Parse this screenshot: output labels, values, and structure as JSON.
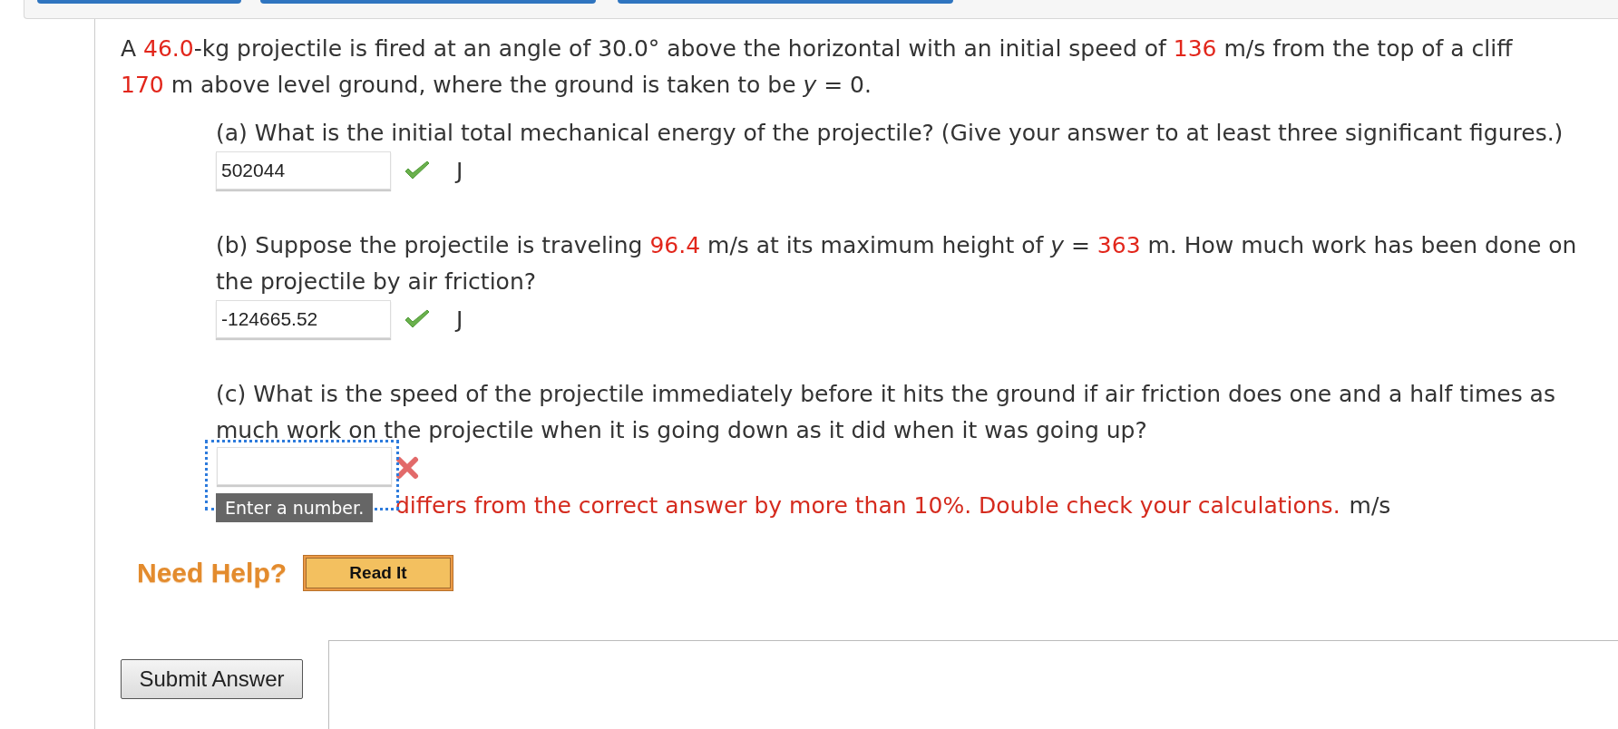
{
  "problem": {
    "segments": [
      {
        "kind": "plain",
        "text": "A "
      },
      {
        "kind": "value",
        "text": "46.0"
      },
      {
        "kind": "plain",
        "text": "-kg projectile is fired at an angle of 30.0° above the horizontal with an initial speed of "
      },
      {
        "kind": "value",
        "text": "136"
      },
      {
        "kind": "plain",
        "text": " m/s from the top of a cliff "
      },
      {
        "kind": "value",
        "text": "170"
      },
      {
        "kind": "plain",
        "text": " m above level ground, where the ground is taken to be *y* = 0."
      }
    ]
  },
  "parts": [
    {
      "segments": [
        {
          "kind": "plain",
          "text": "(a) What is the initial total mechanical energy of the projectile? (Give your answer to at least three significant figures.)"
        }
      ],
      "answer": {
        "value": "502044",
        "correct": true
      },
      "unit": "J"
    },
    {
      "segments": [
        {
          "kind": "plain",
          "text": "(b) Suppose the projectile is traveling "
        },
        {
          "kind": "value",
          "text": "96.4"
        },
        {
          "kind": "plain",
          "text": " m/s at its maximum height of *y* = "
        },
        {
          "kind": "value",
          "text": "363"
        },
        {
          "kind": "plain",
          "text": " m. How much work has been done on the projectile by air friction?"
        }
      ],
      "answer": {
        "value": "-124665.52",
        "correct": true
      },
      "unit": "J"
    },
    {
      "segments": [
        {
          "kind": "plain",
          "text": "(c) What is the speed of the projectile immediately before it hits the ground if air friction does one and a half times as much work on the projectile when it is going down as it did when it was going up?"
        }
      ],
      "answer": {
        "correct": false,
        "focused": true,
        "tooltip": "Enter a number.",
        "feedback": "differs from the correct answer by more than 10%. Double check your calculations."
      },
      "unit": "m/s"
    }
  ],
  "help": {
    "label": "Need Help?",
    "buttons": [
      "Read It"
    ]
  },
  "submit": {
    "label": "Submit Answer"
  }
}
